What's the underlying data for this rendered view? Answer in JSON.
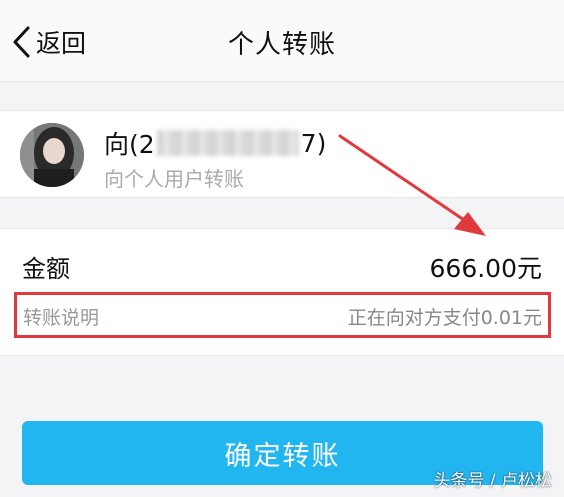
{
  "header": {
    "back_label": "返回",
    "title": "个人转账"
  },
  "recipient": {
    "name_prefix": "向(2",
    "name_suffix": "7)",
    "subtitle": "向个人用户转账"
  },
  "amount": {
    "label": "金额",
    "value": "666.00元"
  },
  "note": {
    "label": "转账说明",
    "value": "正在向对方支付0.01元"
  },
  "confirm_label": "确定转账",
  "watermark": "头条号 / 卢松松",
  "colors": {
    "accent_button": "#22b6f0",
    "annotation_red": "#e03a3e"
  }
}
